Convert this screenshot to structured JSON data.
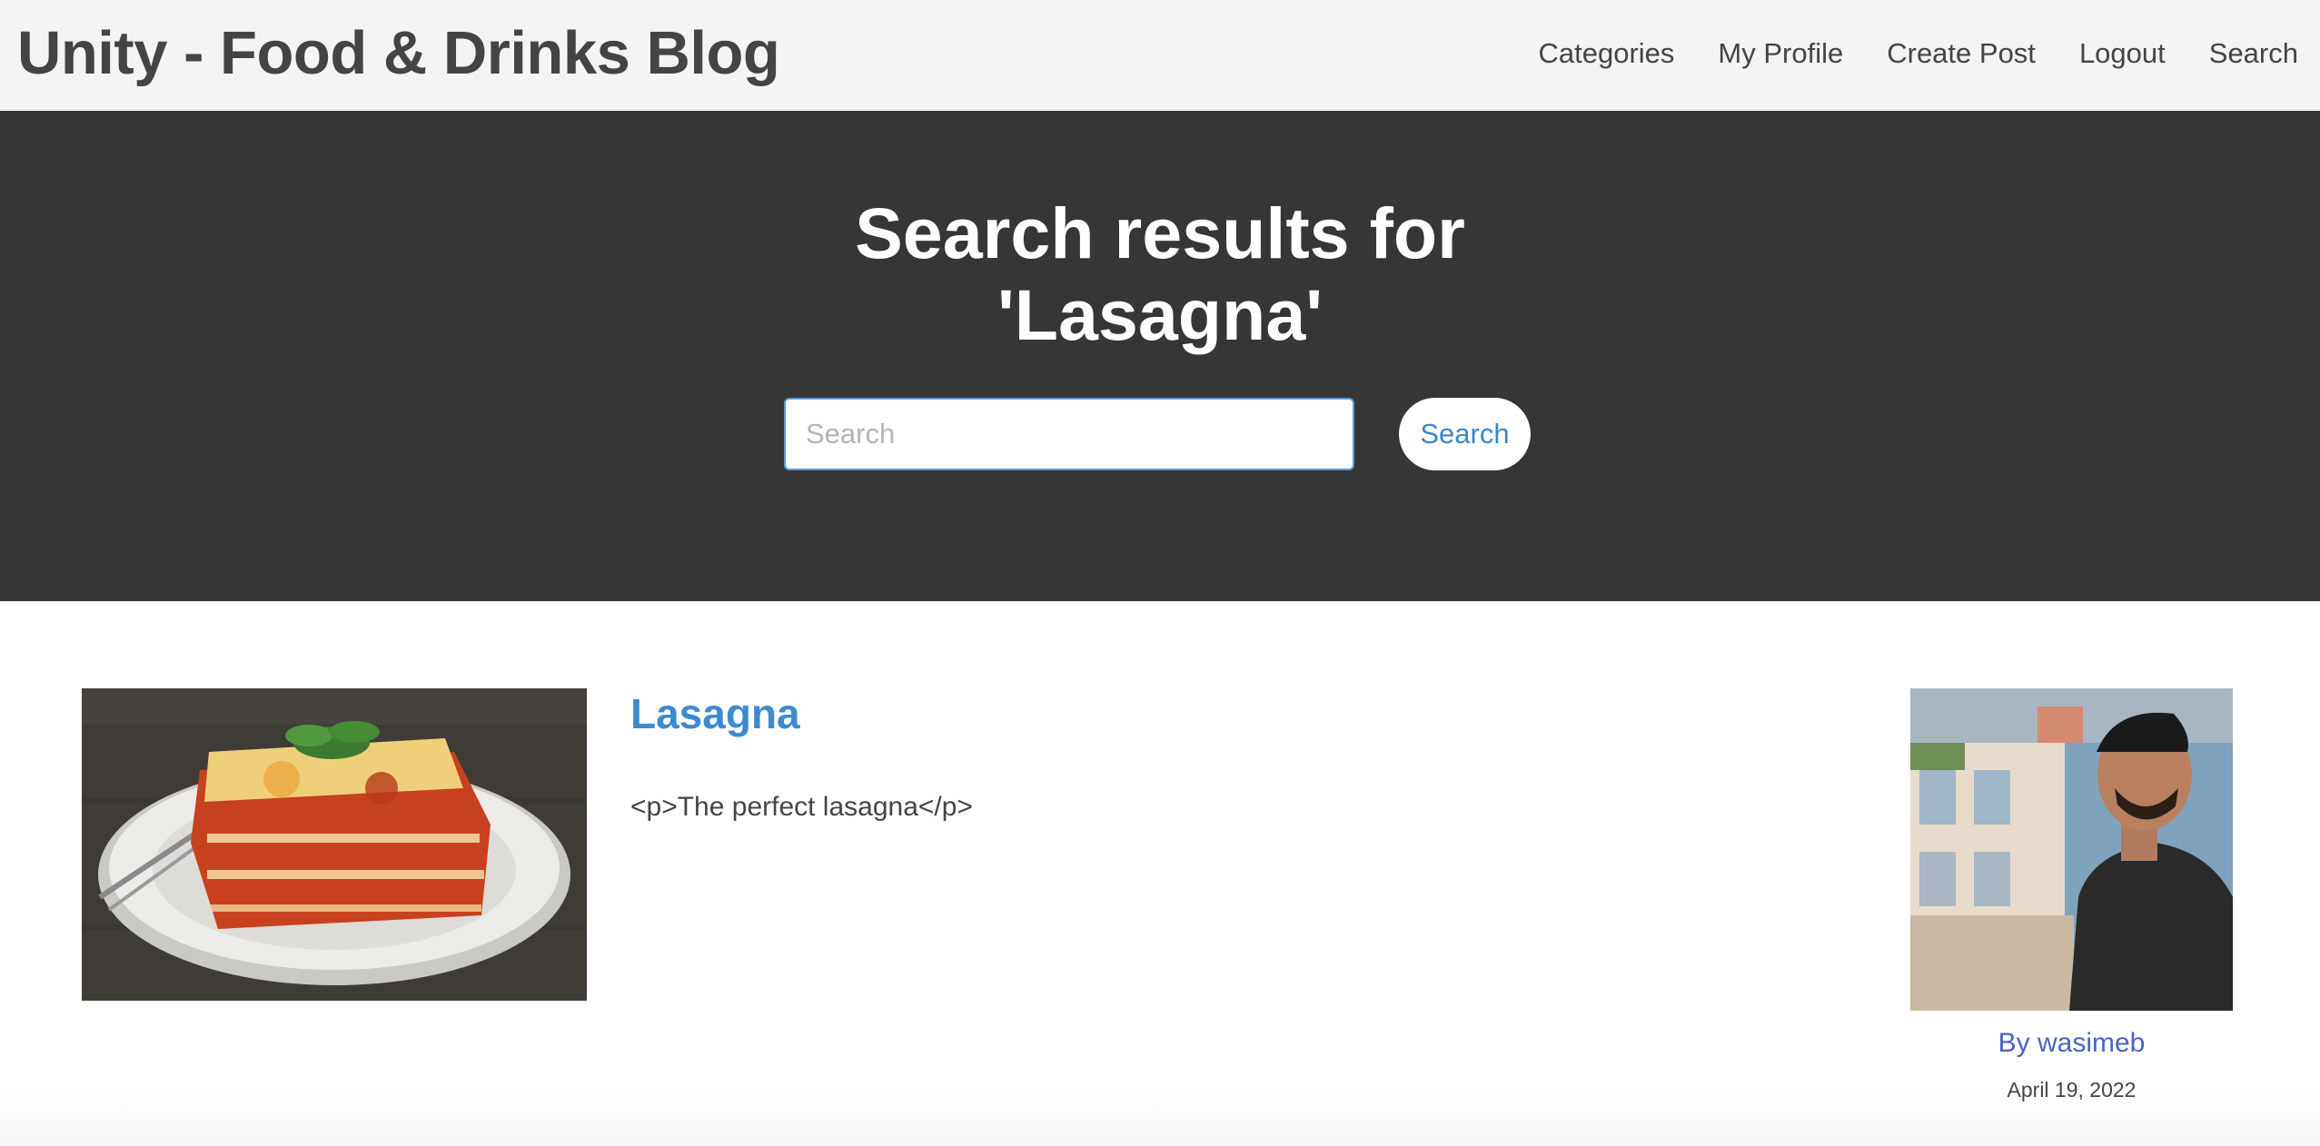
{
  "header": {
    "brand": "Unity - Food & Drinks Blog",
    "nav": [
      "Categories",
      "My Profile",
      "Create Post",
      "Logout",
      "Search"
    ]
  },
  "hero": {
    "title_line1": "Search results for",
    "title_line2": "'Lasagna'",
    "search_placeholder": "Search",
    "search_value": "",
    "search_button": "Search"
  },
  "results": [
    {
      "title": "Lasagna",
      "excerpt": "<p>The perfect lasagna</p>",
      "author": "By wasimeb",
      "date": "April 19, 2022",
      "thumbnail_icon": "lasagna-photo",
      "author_icon": "author-photo"
    }
  ],
  "colors": {
    "nav_bg": "#f4f4f4",
    "hero_bg": "#363636",
    "link_blue": "#3d8bce",
    "author_blue": "#4a63c2"
  }
}
